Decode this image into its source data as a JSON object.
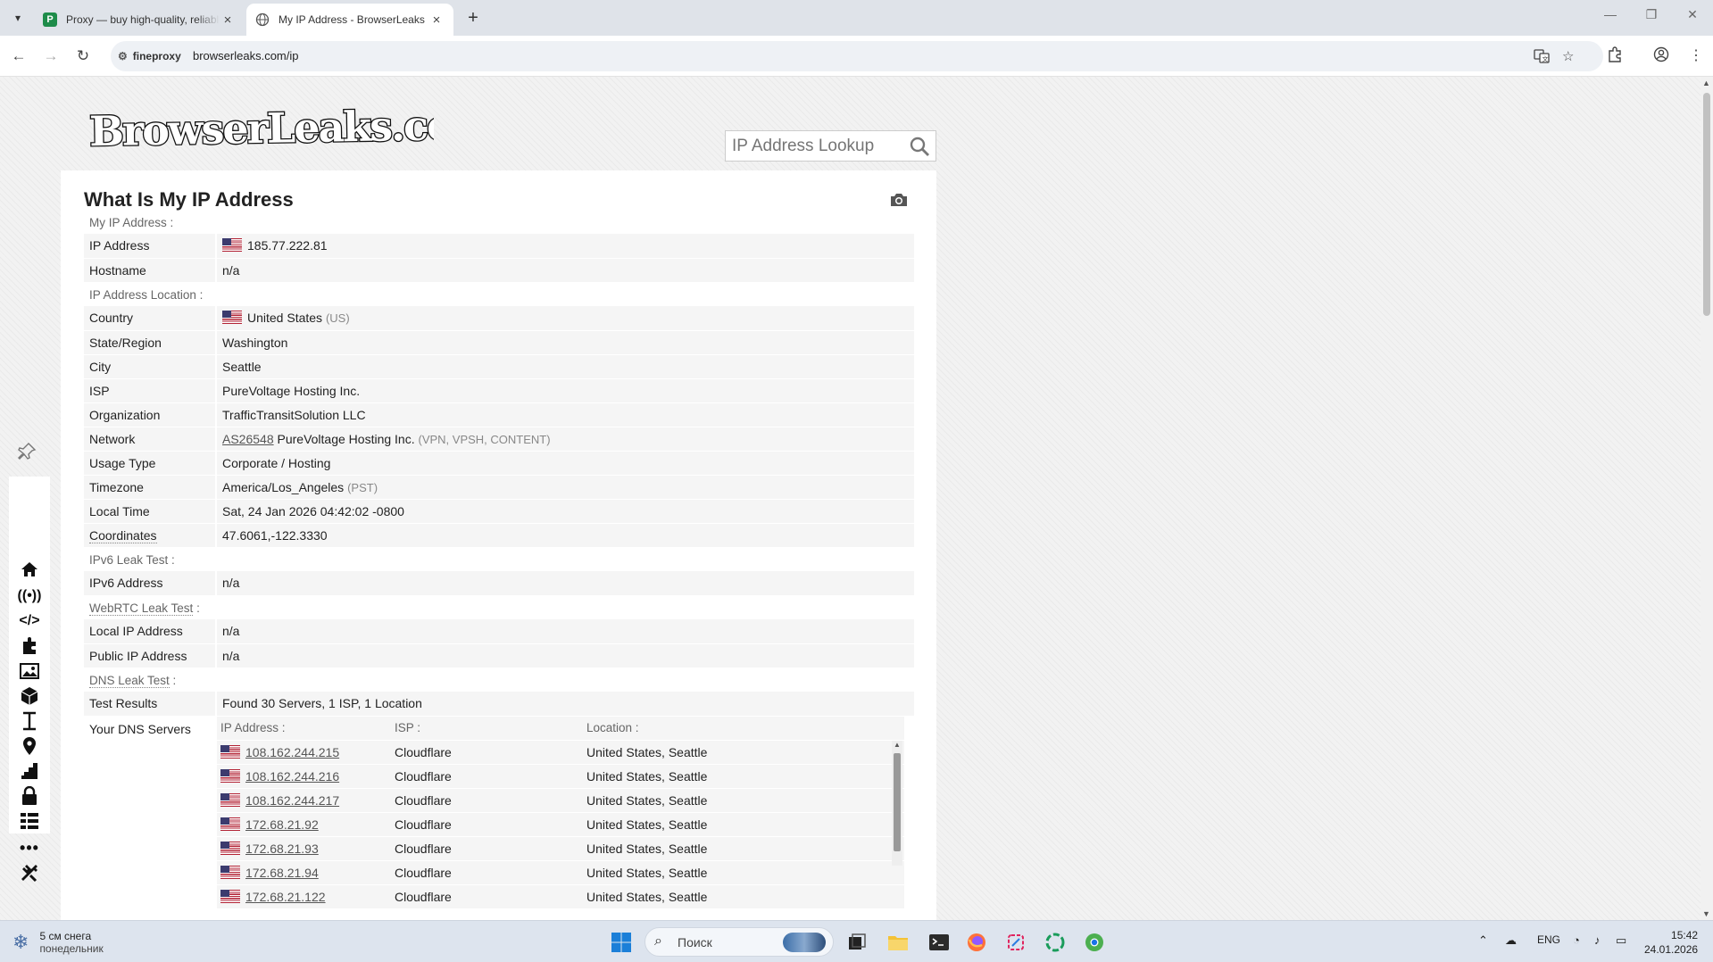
{
  "browser": {
    "tabs": [
      {
        "title": "Proxy — buy high-quality, reliable proxy",
        "active": false
      },
      {
        "title": "My IP Address - BrowserLeaks",
        "active": true
      }
    ],
    "site_chip": "fineproxy",
    "url": "browserleaks.com/ip"
  },
  "site": {
    "logo_text": "BrowserLeaks.com",
    "lookup_placeholder": "IP Address Lookup",
    "page_title": "What Is My IP Address"
  },
  "sections": {
    "my_ip": "My IP Address :",
    "location": "IP Address Location :",
    "ipv6": "IPv6 Leak Test :",
    "webrtc": "WebRTC Leak Test",
    "webrtc_suffix": " :",
    "dns": "DNS Leak Test",
    "dns_suffix": " :"
  },
  "rows": {
    "ip_address": {
      "k": "IP Address",
      "v": "185.77.222.81"
    },
    "hostname": {
      "k": "Hostname",
      "v": "n/a"
    },
    "country": {
      "k": "Country",
      "v": "United States",
      "extra": "(US)"
    },
    "state": {
      "k": "State/Region",
      "v": "Washington"
    },
    "city": {
      "k": "City",
      "v": "Seattle"
    },
    "isp": {
      "k": "ISP",
      "v": "PureVoltage Hosting Inc."
    },
    "org": {
      "k": "Organization",
      "v": "TrafficTransitSolution LLC"
    },
    "network": {
      "k": "Network",
      "asn": "AS26548",
      "v": "PureVoltage Hosting Inc.",
      "extra": "(VPN, VPSH, CONTENT)"
    },
    "usage": {
      "k": "Usage Type",
      "v": "Corporate / Hosting"
    },
    "timezone": {
      "k": "Timezone",
      "v": "America/Los_Angeles",
      "extra": "(PST)"
    },
    "localtime": {
      "k": "Local Time",
      "v": "Sat, 24 Jan 2026 04:42:02 -0800"
    },
    "coords": {
      "k": "Coordinates",
      "v": "47.6061,-122.3330"
    },
    "ipv6addr": {
      "k": "IPv6 Address",
      "v": "n/a"
    },
    "local_ip": {
      "k": "Local IP Address",
      "v": "n/a"
    },
    "public_ip": {
      "k": "Public IP Address",
      "v": "n/a"
    },
    "test_results": {
      "k": "Test Results",
      "v": "Found 30 Servers, 1 ISP, 1 Location"
    },
    "dns_servers": {
      "k": "Your DNS Servers"
    }
  },
  "dns": {
    "headers": [
      "IP Address :",
      "ISP :",
      "Location :"
    ],
    "rows": [
      {
        "ip": "108.162.244.215",
        "isp": "Cloudflare",
        "loc": "United States, Seattle"
      },
      {
        "ip": "108.162.244.216",
        "isp": "Cloudflare",
        "loc": "United States, Seattle"
      },
      {
        "ip": "108.162.244.217",
        "isp": "Cloudflare",
        "loc": "United States, Seattle"
      },
      {
        "ip": "172.68.21.92",
        "isp": "Cloudflare",
        "loc": "United States, Seattle"
      },
      {
        "ip": "172.68.21.93",
        "isp": "Cloudflare",
        "loc": "United States, Seattle"
      },
      {
        "ip": "172.68.21.94",
        "isp": "Cloudflare",
        "loc": "United States, Seattle"
      },
      {
        "ip": "172.68.21.122",
        "isp": "Cloudflare",
        "loc": "United States, Seattle"
      }
    ]
  },
  "sidebar_icons": [
    "home-icon",
    "broadcast-icon",
    "code-icon",
    "puzzle-icon",
    "image-icon",
    "cube-icon",
    "text-cursor-icon",
    "location-pin-icon",
    "stairs-icon",
    "lock-icon",
    "grid-icon",
    "more-icon",
    "tools-icon"
  ],
  "taskbar": {
    "weather_line1": "5 см снега",
    "weather_line2": "понедельник",
    "search_placeholder": "Поиск",
    "lang": "ENG",
    "time": "15:42",
    "date": "24.01.2026"
  }
}
